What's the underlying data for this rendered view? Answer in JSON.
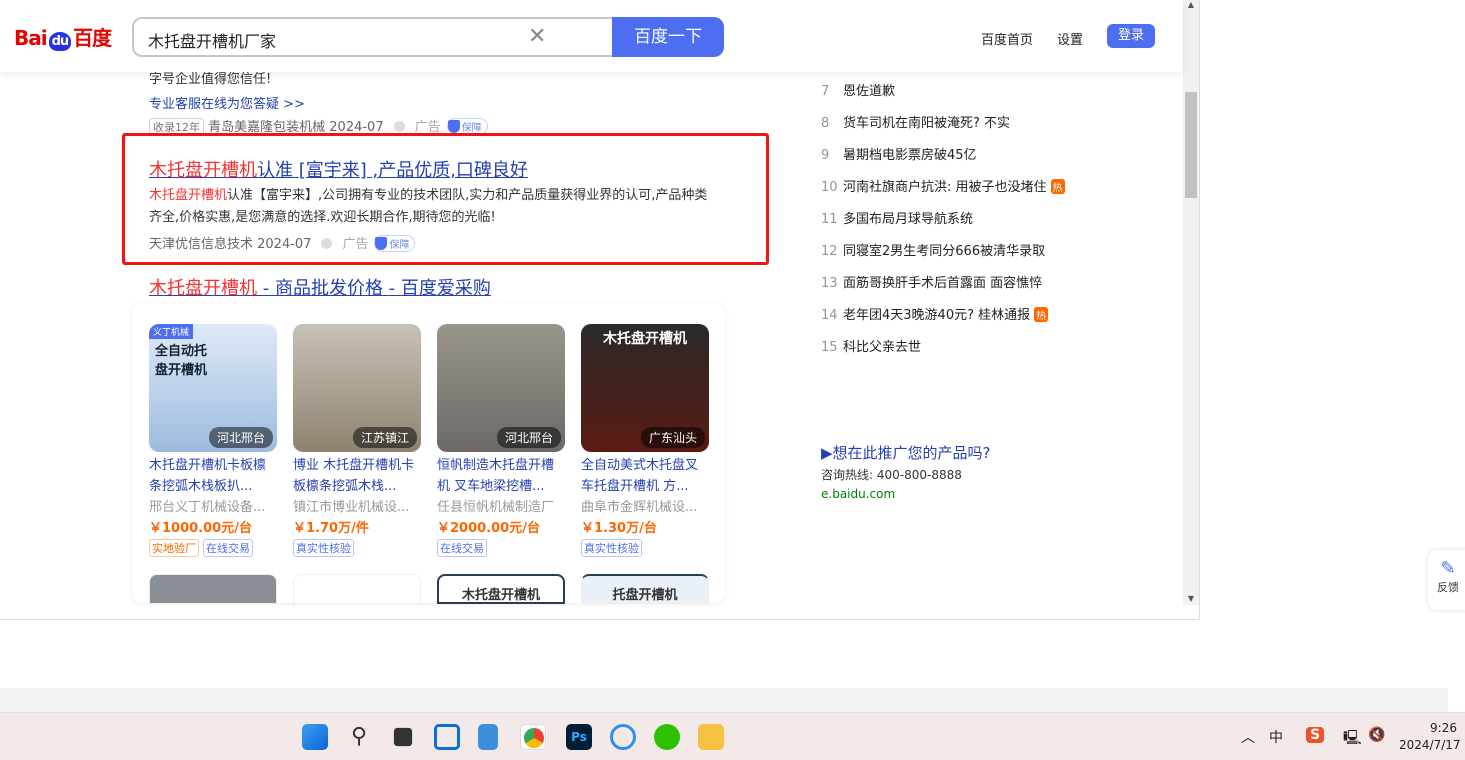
{
  "header": {
    "logo": "Bai度百度",
    "query": "木托盘开槽机厂家",
    "search_button": "百度一下",
    "links": [
      "百度首页",
      "设置"
    ],
    "login": "登录"
  },
  "prev_ad": {
    "tail": "字号企业值得您信任!",
    "service_link": "专业客服在线为您答疑 >>",
    "tag": "收录12年",
    "source": "青岛美嘉隆包装机械 2024-07",
    "ad": "广告",
    "guarantee": "保障"
  },
  "ad2": {
    "title_red": "木托盘开槽机",
    "title_rest": "认准 [富宇来] ,产品优质,口碑良好",
    "desc_red": "木托盘开槽机",
    "desc_rest": "认准【富宇来】,公司拥有专业的技术团队,实力和产品质量获得业界的认可,产品种类齐全,价格实惠,是您满意的选择.欢迎长期合作,期待您的光临!",
    "source": "天津优信信息技术 2024-07",
    "ad": "广告",
    "guarantee": "保障"
  },
  "shop": {
    "title_red": "木托盘开槽机",
    "title_rest": " - 商品批发价格 - 百度爱采购",
    "cards": [
      {
        "img_text": "全自动托盘开槽机",
        "badge": "义丁机械",
        "location": "河北邢台",
        "title": "木托盘开槽机卡板檩条挖弧木栈板扒...",
        "shop": "邢台义丁机械设备...",
        "price": "￥1000.00元/台",
        "tags": [
          "实地验厂",
          "在线交易"
        ]
      },
      {
        "img_text": "",
        "badge": "",
        "location": "江苏镇江",
        "title": "博业 木托盘开槽机卡板檩条挖弧木栈...",
        "shop": "镇江市博业机械设...",
        "price": "￥1.70万/件",
        "tags": [
          "真实性核验"
        ]
      },
      {
        "img_text": "",
        "badge": "",
        "location": "河北邢台",
        "title": "恒帆制造木托盘开槽机 叉车地梁挖槽...",
        "shop": "任县恒帆机械制造厂",
        "price": "￥2000.00元/台",
        "tags": [
          "在线交易"
        ]
      },
      {
        "img_text": "木托盘开槽机",
        "badge": "",
        "location": "广东汕头",
        "title": "全自动美式木托盘叉车托盘开槽机 方...",
        "shop": "曲阜市金辉机械设...",
        "price": "￥1.30万/台",
        "tags": [
          "真实性核验"
        ]
      }
    ],
    "row2": [
      "",
      "",
      "木托盘开槽机",
      "托盘开槽机"
    ]
  },
  "hot": [
    {
      "n": "7",
      "t": "恩佐道歉",
      "hot": ""
    },
    {
      "n": "8",
      "t": "货车司机在南阳被淹死? 不实",
      "hot": ""
    },
    {
      "n": "9",
      "t": "暑期档电影票房破45亿",
      "hot": ""
    },
    {
      "n": "10",
      "t": "河南社旗商户抗洪: 用被子也没堵住",
      "hot": "热"
    },
    {
      "n": "11",
      "t": "多国布局月球导航系统",
      "hot": ""
    },
    {
      "n": "12",
      "t": "同寝室2男生考同分666被清华录取",
      "hot": ""
    },
    {
      "n": "13",
      "t": "面筋哥换肝手术后首露面 面容憔悴",
      "hot": ""
    },
    {
      "n": "14",
      "t": "老年团4天3晚游40元? 桂林通报",
      "hot": "热"
    },
    {
      "n": "15",
      "t": "科比父亲去世",
      "hot": ""
    }
  ],
  "promo": {
    "title": "▶想在此推广您的产品吗?",
    "phone": "咨询热线: 400-800-8888",
    "site": "e.baidu.com"
  },
  "feedback": "反馈",
  "tray": {
    "ime": "中",
    "time": "9:26",
    "date": "2024/7/17"
  }
}
